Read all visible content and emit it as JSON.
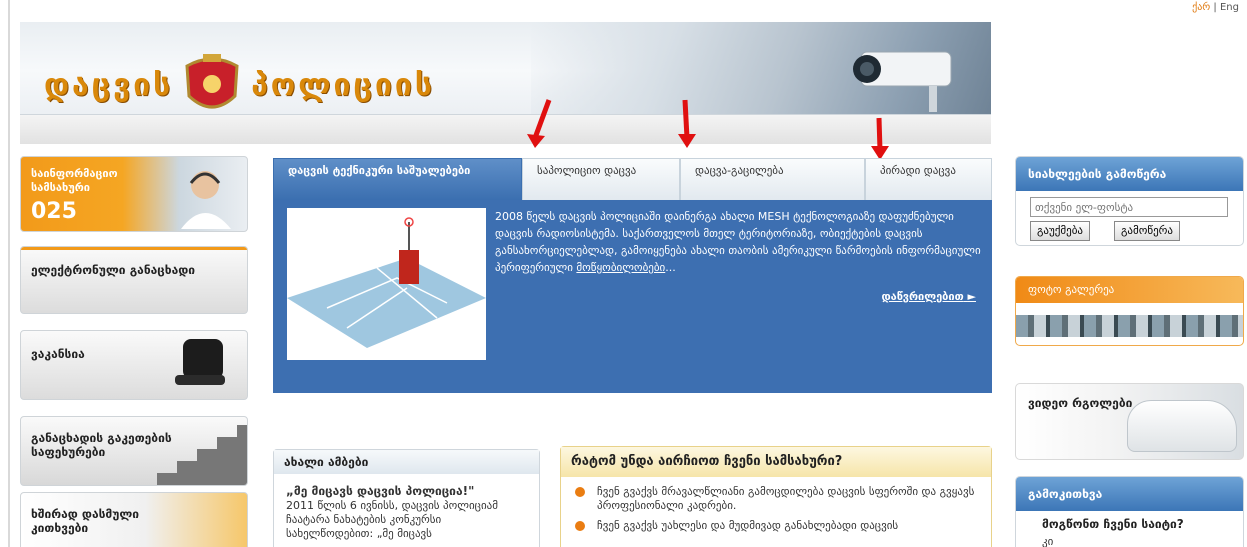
{
  "lang": {
    "ka": "ქარ",
    "sep": " | ",
    "en": "Eng"
  },
  "header": {
    "logo_left": "დაცვის",
    "logo_right": "პოლიციის"
  },
  "left": {
    "info_title": "საინფორმაციო სამსახური",
    "info_number": "025",
    "e_application": "ელექტრონული განაცხადი",
    "vacancy": "ვაკანსია",
    "steps": "განაცხადის გაკეთების საფეხურები",
    "faq": "ხშირად დასმული კითხვები"
  },
  "tabs": [
    {
      "label": "დაცვის ტექნიკური საშუალებები"
    },
    {
      "label": "საპოლიციო დაცვა"
    },
    {
      "label": "დაცვა-გაცილება"
    },
    {
      "label": "პირადი დაცვა"
    }
  ],
  "panel": {
    "text": "2008 წელს დაცვის პოლიციაში დაინერგა ახალი MESH ტექნოლოგიაზე დაფუძნებული დაცვის რადიოსისტემა. საქართველოს მთელ ტერიტორიაზე, ობიექტების დაცვის განსახორციელებლად, გამოიყენება ახალი თაობის ამერიკული წარმოების ინფორმაციული პერიფერიული ",
    "link": "მოწყობილობები",
    "ellipsis": "...",
    "more": "დაწვრილებით"
  },
  "news": {
    "title": "ახალი ამბები",
    "headline": "„მე მიცავს დაცვის პოლიცია!\"",
    "body": "2011 წლის 6 ივნისს, დაცვის პოლიციამ ჩაატარა ნახატების კონკურსი სახელწოდებით: „მე მიცავს"
  },
  "why": {
    "title": "რატომ უნდა აირჩიოთ ჩვენი სამსახური?",
    "items": [
      "ჩვენ გვაქვს მრავალწლიანი გამოცდილება დაცვის სფეროში და გვყავს პროფესიონალი კადრები.",
      "ჩვენ გვაქვს უახლესი და მუდმივად განახლებადი დაცვის"
    ]
  },
  "right": {
    "subscribe_title": "სიახლეების გამოწერა",
    "email_placeholder": "თქვენი ელ-ფოსტა",
    "cancel_btn": "გაუქმება",
    "subscribe_btn": "გამოწერა",
    "photo_title": "ფოტო გალერეა",
    "video_title": "ვიდეო რგოლები",
    "poll_title": "გამოკითხვა",
    "poll_question": "მოგწონთ ჩვენი საიტი?",
    "poll_option": "კი"
  },
  "colors": {
    "accent": "#3d6fb1",
    "orange": "#f29a1a",
    "arrow": "#e01010"
  }
}
